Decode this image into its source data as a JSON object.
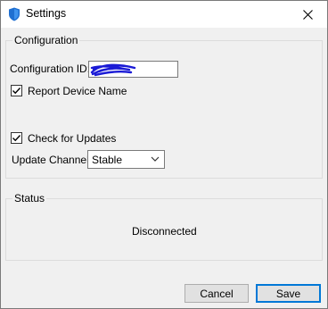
{
  "window": {
    "title": "Settings",
    "icon": "shield-icon",
    "close_icon": "close-icon"
  },
  "configuration": {
    "legend": "Configuration",
    "config_id_label": "Configuration ID:",
    "config_id_value": "",
    "report_device_name_label": "Report Device Name",
    "report_device_name_checked": true,
    "check_updates_label": "Check for Updates",
    "check_updates_checked": true,
    "update_channel_label": "Update Channel:",
    "update_channel_value": "Stable"
  },
  "status": {
    "legend": "Status",
    "text": "Disconnected"
  },
  "buttons": {
    "cancel": "Cancel",
    "save": "Save"
  },
  "colors": {
    "accent": "#0078d7",
    "scribble": "#1b1bd6",
    "shield": "#1f6fd1"
  }
}
